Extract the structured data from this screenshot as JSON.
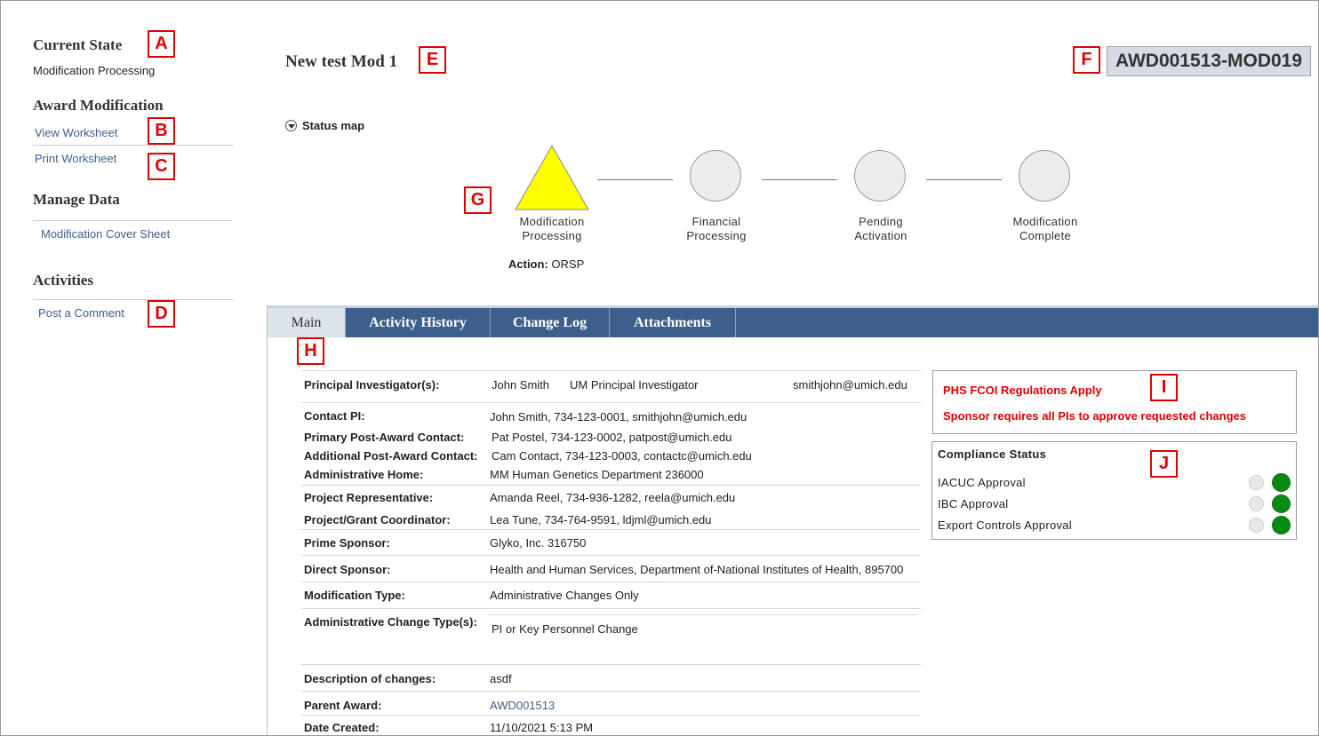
{
  "sidebar": {
    "current_state_title": "Current State",
    "current_state_value": "Modification Processing",
    "award_mod_title": "Award Modification",
    "view_worksheet": "View Worksheet",
    "print_worksheet": "Print Worksheet",
    "manage_data_title": "Manage Data",
    "mod_cover_sheet": "Modification Cover Sheet",
    "activities_title": "Activities",
    "post_comment": "Post a Comment"
  },
  "callouts": {
    "a": "A",
    "b": "B",
    "c": "C",
    "d": "D",
    "e": "E",
    "f": "F",
    "g": "G",
    "h": "H",
    "i": "I",
    "j": "J"
  },
  "header": {
    "title": "New test  Mod 1",
    "record_id": "AWD001513-MOD019"
  },
  "status_map": {
    "label": "Status map",
    "steps": [
      {
        "line1": "Modification",
        "line2": "Processing"
      },
      {
        "line1": "Financial",
        "line2": "Processing"
      },
      {
        "line1": "Pending",
        "line2": "Activation"
      },
      {
        "line1": "Modification",
        "line2": "Complete"
      }
    ],
    "action_label": "Action:",
    "action_value": "ORSP",
    "current_color": "#ffff00"
  },
  "tabs": [
    {
      "label": "Main"
    },
    {
      "label": "Activity History"
    },
    {
      "label": "Change Log"
    },
    {
      "label": "Attachments"
    }
  ],
  "details": {
    "pi_label": "Principal Investigator(s):",
    "pi_name": "John Smith",
    "pi_role": "UM Principal Investigator",
    "pi_email": "smithjohn@umich.edu",
    "contact_pi_label": "Contact PI:",
    "contact_pi_value": "John Smith,  734-123-0001,  smithjohn@umich.edu",
    "primary_post_label": "Primary Post-Award Contact:",
    "primary_post_value": "Pat Postel,  734-123-0002,  patpost@umich.edu",
    "additional_post_label": "Additional Post-Award Contact:",
    "additional_post_value": "Cam Contact,  734-123-0003,  contactc@umich.edu",
    "admin_home_label": "Administrative Home:",
    "admin_home_value": "MM Human Genetics Department  236000",
    "project_rep_label": "Project Representative:",
    "project_rep_value": "Amanda Reel,  734-936-1282,  reela@umich.edu",
    "grant_coord_label": "Project/Grant Coordinator:",
    "grant_coord_value": "Lea Tune,  734-764-9591,  ldjml@umich.edu",
    "prime_sponsor_label": "Prime Sponsor:",
    "prime_sponsor_value": "Glyko, Inc.  316750",
    "direct_sponsor_label": "Direct Sponsor:",
    "direct_sponsor_value": "Health and Human Services, Department of-National Institutes of Health,  895700",
    "mod_type_label": "Modification Type:",
    "mod_type_value": "Administrative Changes Only",
    "admin_change_label": "Administrative Change Type(s):",
    "admin_change_value": "PI or Key Personnel Change",
    "desc_label": "Description of changes:",
    "desc_value": "asdf",
    "parent_award_label": "Parent Award:",
    "parent_award_value": "AWD001513",
    "date_created_label": "Date Created:",
    "date_created_value": "11/10/2021 5:13 PM"
  },
  "notices": {
    "fcoi": "PHS FCOI Regulations Apply",
    "sponsor_approval": "Sponsor requires all PIs to approve requested changes"
  },
  "compliance": {
    "title": "Compliance Status",
    "items": [
      {
        "label": "IACUC Approval",
        "status": "green"
      },
      {
        "label": "IBC Approval",
        "status": "green"
      },
      {
        "label": "Export Controls Approval",
        "status": "green"
      }
    ]
  }
}
